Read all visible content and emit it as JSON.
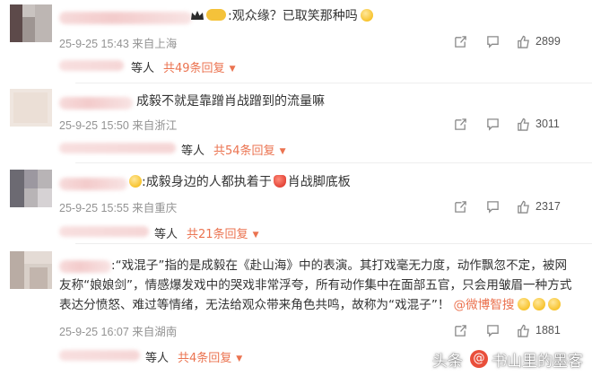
{
  "comments": [
    {
      "text": ":观众缘？已取笑那种吗",
      "time": "25-9-25 15:43 来自上海",
      "likes": "2899",
      "reply_people": "等人",
      "reply_count": "共49条回复"
    },
    {
      "text": "成毅不就是靠蹭肖战蹭到的流量嘛",
      "time": "25-9-25 15:50 来自浙江",
      "likes": "3011",
      "reply_people": "等人",
      "reply_count": "共54条回复"
    },
    {
      "text_a": ":成毅身边的人都执着于",
      "text_b": "肖战脚底板",
      "time": "25-9-25 15:55 来自重庆",
      "likes": "2317",
      "reply_people": "等人",
      "reply_count": "共21条回复"
    },
    {
      "line1": ":“戏混子”指的是成毅在《赴山海》中的表演。其打戏毫无力度，动作飘忽不定，被网",
      "line2": "友称“娘娘剑”，情感爆发戏中的哭戏非常浮夸，所有动作集中在面部五官，只会用皱眉一种方式",
      "line3a": "表达分愤怒、难过等情绪，无法给观众带来角色共鸣，故称为“戏混子”！",
      "line3_link": "@微博智搜",
      "time": "25-9-25 16:07 来自湖南",
      "likes": "1881",
      "reply_people": "等人",
      "reply_count": "共4条回复"
    }
  ],
  "watermark": {
    "prefix": "头条",
    "author": "书山里的墨客"
  },
  "colors": {
    "accent": "#eb7350",
    "meta": "#939393",
    "link": "#eb7350"
  },
  "icons": [
    "share-icon",
    "comment-icon",
    "like-icon",
    "caret-down-icon",
    "crown-icon"
  ]
}
